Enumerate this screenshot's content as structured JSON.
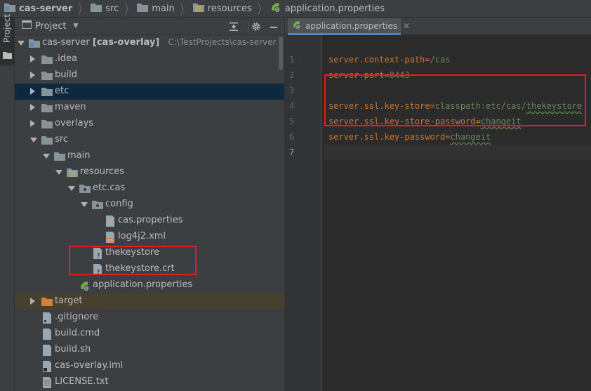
{
  "breadcrumb": [
    {
      "label": "cas-server",
      "icon": "module-folder-icon"
    },
    {
      "label": "src",
      "icon": "folder-icon"
    },
    {
      "label": "main",
      "icon": "folder-icon"
    },
    {
      "label": "resources",
      "icon": "resources-folder-icon"
    },
    {
      "label": "application.properties",
      "icon": "spring-properties-icon"
    }
  ],
  "stripe": {
    "project_tab": "Project"
  },
  "panel": {
    "title": "Project"
  },
  "tree": {
    "root": {
      "name": "cas-server",
      "module": "[cas-overlay]",
      "path": "C:\\TestProjects\\cas-server"
    },
    "idea": ".idea",
    "build": "build",
    "etc": "etc",
    "maven": "maven",
    "overlays": "overlays",
    "src": "src",
    "main": "main",
    "resources": "resources",
    "etccas": "etc.cas",
    "config": "config",
    "cas_properties": "cas.properties",
    "log4j2": "log4j2.xml",
    "thekeystore": "thekeystore",
    "thekeystore_crt": "thekeystore.crt",
    "application_properties": "application.properties",
    "target": "target",
    "gitignore": ".gitignore",
    "build_cmd": "build.cmd",
    "build_sh": "build.sh",
    "cas_overlay_iml": "cas-overlay.iml",
    "license": "LICENSE.txt"
  },
  "editor": {
    "tab_label": "application.properties",
    "line_numbers": [
      "1",
      "2",
      "3",
      "4",
      "5",
      "6",
      "7"
    ],
    "lines": [
      {
        "key": "server.context-path",
        "value": "/cas"
      },
      {
        "key": "server.port",
        "value": "8443"
      },
      {
        "key": "",
        "value": ""
      },
      {
        "key": "server.ssl.key-store",
        "value_prefix": "classpath:etc/cas/",
        "value_squiggle": "thekeystore"
      },
      {
        "key": "server.ssl.key-store-password",
        "value_squiggle": "changeit"
      },
      {
        "key": "server.ssl.key-password",
        "value_squiggle": "changeit"
      },
      {
        "key": "",
        "value": ""
      }
    ]
  },
  "colors": {
    "key": "#cc7832",
    "value": "#6a8759",
    "highlight_box": "#e51d1d",
    "selection": "#0d293e",
    "excluded": "#48402f"
  }
}
